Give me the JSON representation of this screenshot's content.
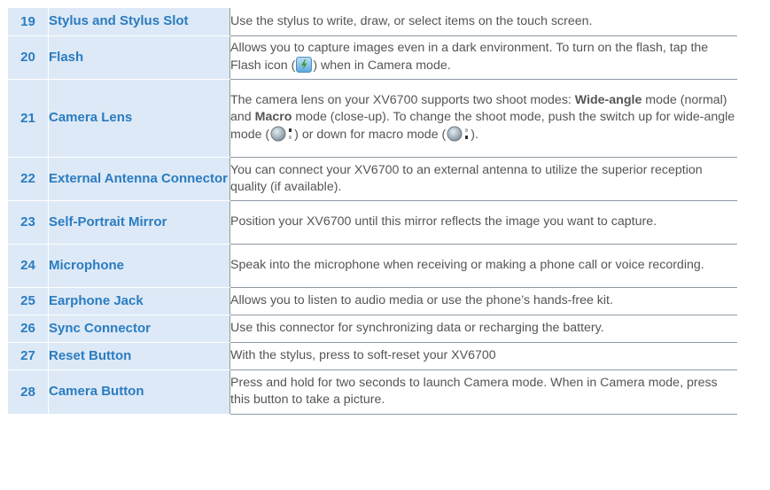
{
  "rows": [
    {
      "num": "19",
      "name": "Stylus and Stylus Slot",
      "desc": "Use the stylus to write, draw, or select items on the touch screen."
    },
    {
      "num": "20",
      "name": "Flash",
      "desc_a": "Allows you to capture images even in a dark environment. To turn on the flash, tap the Flash icon (",
      "desc_b": ") when in Camera mode."
    },
    {
      "num": "21",
      "name": "Camera Lens",
      "desc_a": "The camera lens on your XV6700 supports two shoot modes: ",
      "bold_1": "Wide-angle",
      "desc_b": " mode (normal) and ",
      "bold_2": "Macro",
      "desc_c": " mode (close-up). To change the shoot mode, push the switch up for wide-angle mode (",
      "desc_d": ") or down for macro mode (",
      "desc_e": ")."
    },
    {
      "num": "22",
      "name": "External Antenna Connector",
      "desc": "You can connect your XV6700 to an external antenna to utilize the superior reception quality (if available)."
    },
    {
      "num": "23",
      "name": "Self-Portrait Mirror",
      "desc": "Position your XV6700 until this mirror reflects the image you want to capture."
    },
    {
      "num": "24",
      "name": "Microphone",
      "desc": "Speak into the microphone when receiving or making a phone call or voice recording."
    },
    {
      "num": "25",
      "name": "Earphone Jack",
      "desc": "Allows you to listen to audio media or use the phone’s hands-free kit."
    },
    {
      "num": "26",
      "name": "Sync Connector",
      "desc": "Use this connector for synchronizing data or recharging the battery."
    },
    {
      "num": "27",
      "name": "Reset Button",
      "desc": "With the stylus, press to soft-reset your XV6700"
    },
    {
      "num": "28",
      "name": "Camera Button",
      "desc": "Press and hold for two seconds to launch Camera mode. When in Camera mode, press this button to take a picture."
    }
  ],
  "icons": {
    "flash": "flash-icon",
    "wide_angle": "wide-angle-mode-icon",
    "macro": "macro-mode-icon"
  },
  "colors": {
    "label_bg": "#dde9f6",
    "label_text": "#2a7cc1",
    "desc_text": "#555555",
    "grid": "#8e9aa3"
  }
}
